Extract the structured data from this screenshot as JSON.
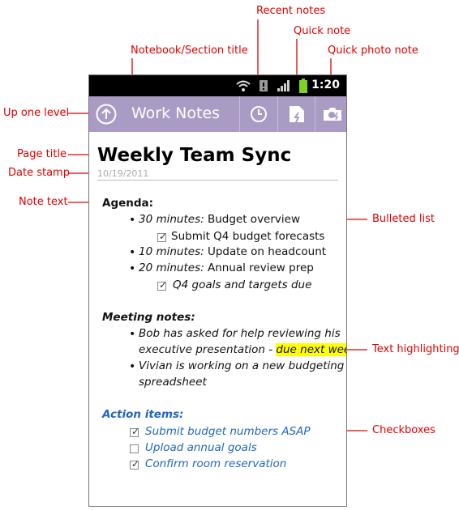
{
  "callouts": {
    "recent_notes": "Recent notes",
    "quick_note": "Quick note",
    "notebook_section_title": "Notebook/Section title",
    "quick_photo_note": "Quick photo note",
    "up_one_level": "Up one level",
    "page_title": "Page title",
    "date_stamp": "Date stamp",
    "note_text": "Note text",
    "bulleted_list": "Bulleted list",
    "text_highlighting": "Text highlighting",
    "checkboxes": "Checkboxes"
  },
  "statusbar": {
    "time": "1:20"
  },
  "actionbar": {
    "title": "Work Notes"
  },
  "page": {
    "title": "Weekly Team Sync",
    "date": "10/19/2011"
  },
  "agenda": {
    "heading": "Agenda:",
    "items": [
      {
        "time": "30 minutes:",
        "text": " Budget overview",
        "task": "Submit Q4 budget forecasts"
      },
      {
        "time": "10 minutes:",
        "text": " Update on headcount"
      },
      {
        "time": "20 minutes:",
        "text": " Annual review prep",
        "task": "Q4 goals and targets due"
      }
    ]
  },
  "meeting": {
    "heading": "Meeting notes:",
    "item1_line1": "Bob has asked for help reviewing his",
    "item1_line2a": "executive presentation - ",
    "item1_highlight": "due next week",
    "item2_line1": "Vivian is working on a new budgeting",
    "item2_line2": "spreadsheet"
  },
  "actions": {
    "heading": "Action items:",
    "items": [
      {
        "label": "Submit budget numbers ASAP",
        "checked": true
      },
      {
        "label": "Upload annual goals",
        "checked": false
      },
      {
        "label": "Confirm room reservation",
        "checked": true
      }
    ]
  },
  "colors": {
    "callout": "#e00000",
    "actionbar": "#a99bc3",
    "action_items": "#2266bb",
    "highlight": "#ffff00"
  }
}
